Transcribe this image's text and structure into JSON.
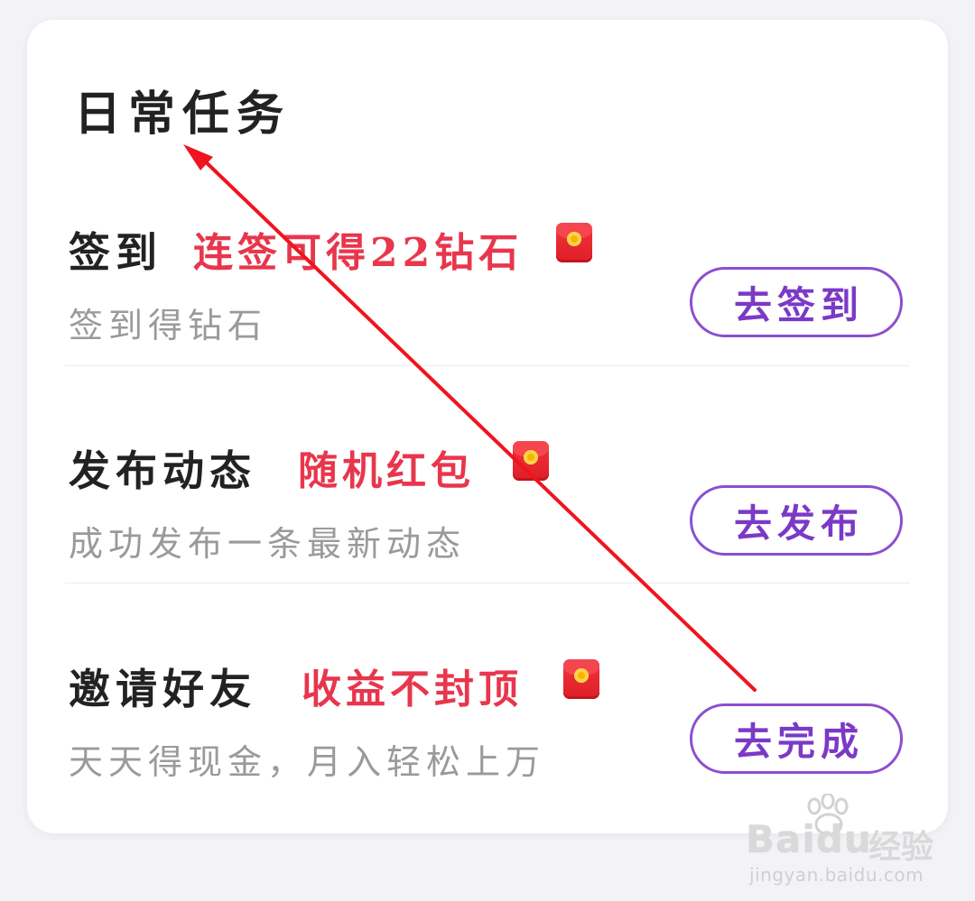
{
  "card": {
    "title": "日常任务"
  },
  "tasks": [
    {
      "name": "签到",
      "reward": "连签可得22钻石",
      "reward_icon": "red-packet-icon",
      "description": "签到得钻石",
      "button_label": "去签到"
    },
    {
      "name": "发布动态",
      "reward": "随机红包",
      "reward_icon": "red-packet-icon",
      "description": "成功发布一条最新动态",
      "button_label": "去发布"
    },
    {
      "name": "邀请好友",
      "reward": "收益不封顶",
      "reward_icon": "red-packet-icon",
      "description": "天天得现金，月入轻松上万",
      "button_label": "去完成"
    }
  ],
  "watermark": {
    "brand": "Baidu",
    "brand_cn": "经验",
    "url": "jingyan.baidu.com"
  },
  "colors": {
    "reward_text": "#e8364c",
    "button_border": "#8c4ed0",
    "button_text": "#7b39c6",
    "annotation_arrow": "#f0141e"
  }
}
